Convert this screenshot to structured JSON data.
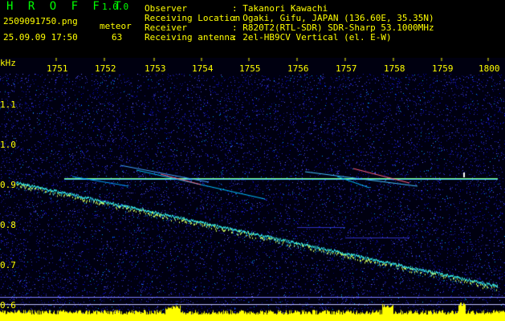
{
  "app": {
    "name": "H R O F F T",
    "version": "1.0.0"
  },
  "file": {
    "name": "2509091750.png",
    "datetime": "25.09.09 17:50"
  },
  "meteor": {
    "label": "meteor",
    "count": "63"
  },
  "info": [
    {
      "key": "Observer",
      "value": ": Takanori Kawachi"
    },
    {
      "key": "Receiving Location",
      "value": ": Ogaki, Gifu, JAPAN (136.60E, 35.35N)"
    },
    {
      "key": "Receiver",
      "value": ": R820T2(RTL-SDR) SDR-Sharp 53.1000MHz"
    },
    {
      "key": "Receiving antenna",
      "value": ": 2el-HB9CV Vertical (el. E-W)"
    }
  ],
  "axis": {
    "unit": "kHz",
    "time_ticks": [
      "1751",
      "1752",
      "1753",
      "1754",
      "1755",
      "1756",
      "1757",
      "1758",
      "1759",
      "1800"
    ],
    "freq_ticks": [
      "1.1",
      "1.0",
      "0.9",
      "0.8",
      "0.7",
      "0.6"
    ]
  },
  "colors": {
    "background": "#000000",
    "text": "#ffff00",
    "title": "#00ff00",
    "noise": "#1a1aa0",
    "echo": "#00e0ff",
    "trace": "#40ffff",
    "marker": "#ffffff"
  }
}
